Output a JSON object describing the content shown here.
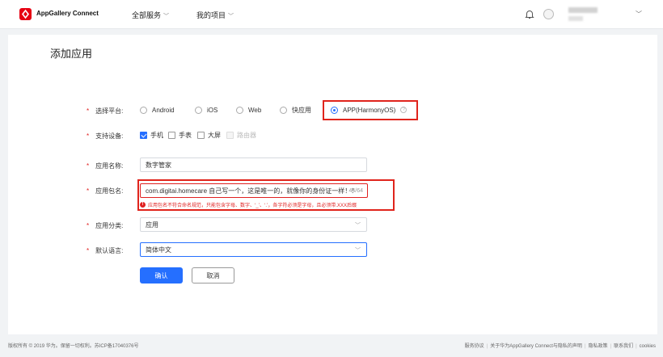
{
  "header": {
    "app_title": "AppGallery Connect",
    "nav": [
      "全部服务",
      "我的项目"
    ]
  },
  "form": {
    "title": "添加应用",
    "platform": {
      "label": "选择平台:",
      "options": [
        "Android",
        "iOS",
        "Web",
        "快应用",
        "APP(HarmonyOS)"
      ],
      "selected": "APP(HarmonyOS)"
    },
    "devices": {
      "label": "支持设备:",
      "options": [
        {
          "label": "手机",
          "checked": true,
          "disabled": false
        },
        {
          "label": "手表",
          "checked": false,
          "disabled": false
        },
        {
          "label": "大屏",
          "checked": false,
          "disabled": false
        },
        {
          "label": "路由器",
          "checked": false,
          "disabled": true
        }
      ]
    },
    "app_name": {
      "label": "应用名称:",
      "value": "数字管家"
    },
    "package_name": {
      "label": "应用包名:",
      "value": "com.digitai.homecare 自己写一个，这是唯一的，就像你的身份证一样！！",
      "counter": "44/64",
      "error": "应用包名不符合命名规范，只能包含字母、数字、‘_’、‘.’，各字符必须是字母，且必须带.XXX后缀"
    },
    "category": {
      "label": "应用分类:",
      "value": "应用"
    },
    "language": {
      "label": "默认语言:",
      "value": "简体中文"
    },
    "confirm_label": "确认",
    "cancel_label": "取消"
  },
  "footer": {
    "copyright": "版权所有 © 2019 华为。保留一切权利。苏ICP备17040376号",
    "links": [
      "服务协议",
      "关于华为AppGallery Connect与隐私的声明",
      "隐私政策",
      "联系我们",
      "cookies"
    ]
  },
  "colors": {
    "accent": "#256fff",
    "error": "#e02020",
    "brand": "#e60012"
  }
}
